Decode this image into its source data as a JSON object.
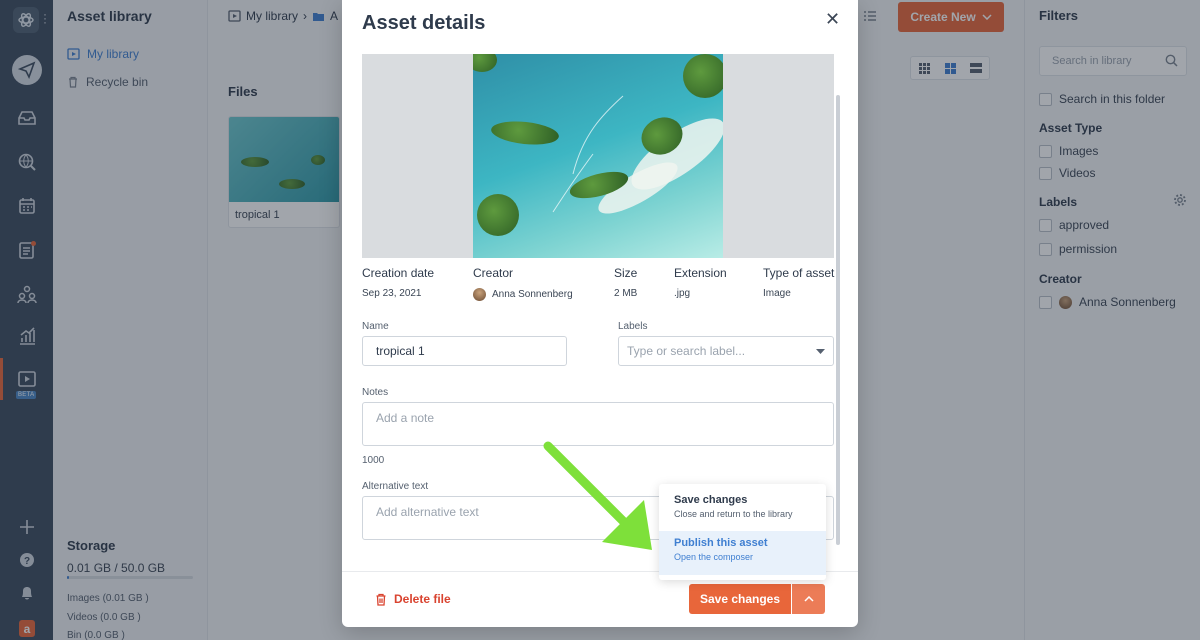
{
  "sidebar": {
    "title": "Asset library",
    "nav": [
      {
        "label": "My library"
      },
      {
        "label": "Recycle bin"
      }
    ],
    "storage": {
      "title": "Storage",
      "usage": "0.01 GB / 50.0 GB",
      "usage_fraction": 0.0002,
      "images": "Images (0.01 GB )",
      "videos": "Videos (0.0 GB )",
      "bin": "Bin (0.0 GB )"
    }
  },
  "rail": {
    "beta_badge": "BETA"
  },
  "main": {
    "breadcrumb": {
      "root": "My library",
      "current": "A"
    },
    "section_title": "Files",
    "file_card": {
      "name": "tropical 1"
    },
    "create_button": "Create New"
  },
  "filters": {
    "title": "Filters",
    "search_placeholder": "Search in library",
    "search_in_folder": "Search in this folder",
    "asset_type_title": "Asset Type",
    "asset_types": [
      "Images",
      "Videos"
    ],
    "labels_title": "Labels",
    "labels": [
      "approved",
      "permission"
    ],
    "creator_title": "Creator",
    "creator": "Anna Sonnenberg"
  },
  "modal": {
    "title": "Asset details",
    "meta": {
      "headers": [
        "Creation date",
        "Creator",
        "Size",
        "Extension",
        "Type of asset"
      ],
      "values": [
        "Sep 23, 2021",
        "Anna Sonnenberg",
        "2 MB",
        ".jpg",
        "Image"
      ]
    },
    "name_label": "Name",
    "name_value": "tropical 1",
    "labels_label": "Labels",
    "labels_placeholder": "Type or search label...",
    "notes_label": "Notes",
    "notes_placeholder": "Add a note",
    "notes_counter": "1000",
    "alt_label": "Alternative text",
    "alt_placeholder": "Add alternative text",
    "delete_label": "Delete file",
    "save_button": "Save changes",
    "dropdown": {
      "save_title": "Save changes",
      "save_sub": "Close and return to the library",
      "publish_title": "Publish this asset",
      "publish_sub": "Open the composer"
    }
  },
  "colors": {
    "accent": "#e8663a",
    "link": "#3f7fd1",
    "danger": "#d9432f",
    "arrow": "#7ee03a"
  }
}
